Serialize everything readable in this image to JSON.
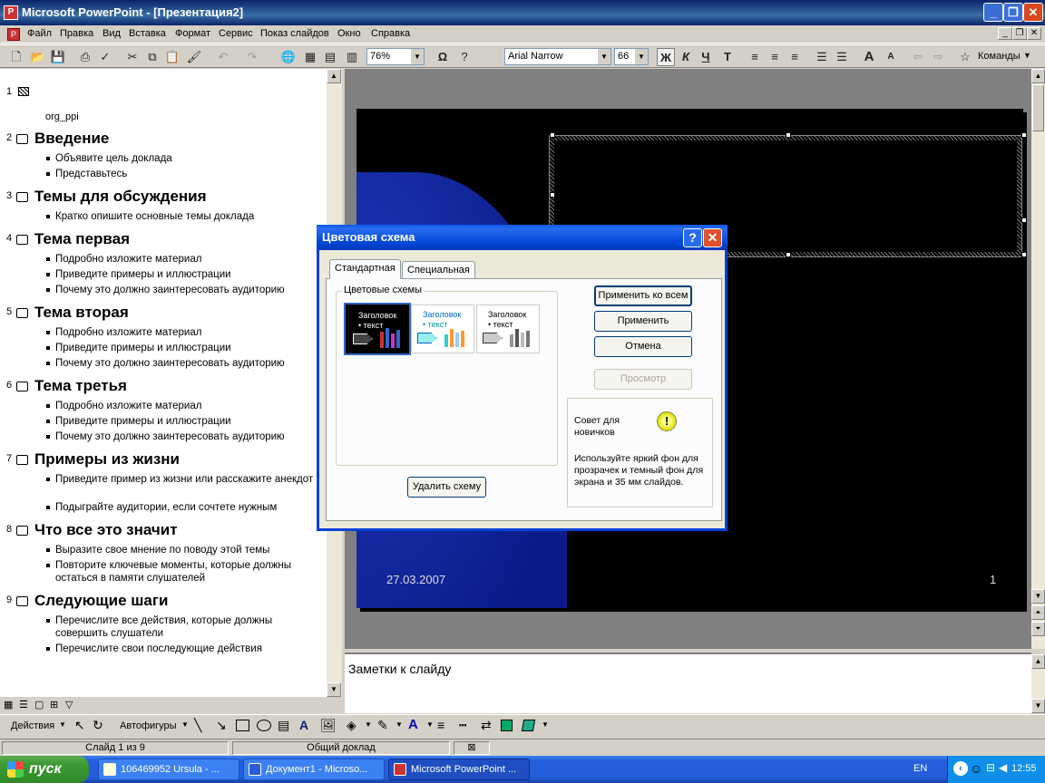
{
  "window": {
    "title": "Microsoft PowerPoint - [Презентация2]",
    "app_icon": "powerpoint-icon",
    "min_glyph": "_",
    "restore_glyph": "❐",
    "close_glyph": "✕"
  },
  "menu": {
    "items": [
      "Файл",
      "Правка",
      "Вид",
      "Вставка",
      "Формат",
      "Сервис",
      "Показ слайдов",
      "Окно",
      "Справка"
    ]
  },
  "toolbar": {
    "zoom": "76%",
    "font_name": "Arial Narrow",
    "font_size": "66",
    "bold": "Ж",
    "italic": "К",
    "underline": "Ч",
    "shadow": "Т",
    "commands_label": "Команды"
  },
  "outline": {
    "slides": [
      {
        "num": "1",
        "title": "",
        "subtitle": "org_ppi",
        "bullets": []
      },
      {
        "num": "2",
        "title": "Введение",
        "bullets": [
          "Объявите цель доклада",
          "Представьтесь"
        ]
      },
      {
        "num": "3",
        "title": "Темы для обсуждения",
        "bullets": [
          "Кратко опишите основные темы доклада"
        ]
      },
      {
        "num": "4",
        "title": "Тема первая",
        "bullets": [
          "Подробно изложите материал",
          "Приведите примеры и иллюстрации",
          "Почему это должно заинтересовать аудиторию"
        ]
      },
      {
        "num": "5",
        "title": "Тема вторая",
        "bullets": [
          "Подробно изложите материал",
          "Приведите примеры и иллюстрации",
          "Почему это должно заинтересовать аудиторию"
        ]
      },
      {
        "num": "6",
        "title": "Тема третья",
        "bullets": [
          "Подробно изложите материал",
          "Приведите примеры и иллюстрации",
          "Почему это должно заинтересовать аудиторию"
        ]
      },
      {
        "num": "7",
        "title": "Примеры из жизни",
        "bullets": [
          "Приведите пример из жизни или расскажите анекдот",
          "Подыграйте аудитории, если сочтете нужным"
        ]
      },
      {
        "num": "8",
        "title": "Что все это значит",
        "bullets": [
          "Выразите свое мнение по поводу этой темы",
          "Повторите ключевые моменты, которые должны остаться в памяти слушателей"
        ]
      },
      {
        "num": "9",
        "title": "Следующие шаги",
        "bullets": [
          "Перечислите все действия, которые должны совершить слушатели",
          "Перечислите свои последующие действия"
        ]
      }
    ]
  },
  "slide": {
    "date": "27.03.2007",
    "page": "1"
  },
  "notes": {
    "placeholder": "Заметки к слайду"
  },
  "dialog": {
    "title": "Цветовая схема",
    "help_glyph": "?",
    "close_glyph": "✕",
    "tabs": [
      "Стандартная",
      "Специальная"
    ],
    "group_label": "Цветовые схемы",
    "scheme_title": "Заголовок",
    "scheme_text": "• текст",
    "buttons": {
      "apply_all": "Применить ко всем",
      "apply": "Применить",
      "cancel": "Отмена",
      "preview": "Просмотр",
      "delete": "Удалить схему"
    },
    "tip_title": "Совет для новичков",
    "tip_text": "Используйте яркий фон для прозрачек и темный фон для экрана и 35 мм слайдов."
  },
  "drawbar": {
    "actions": "Действия",
    "autoshapes": "Автофигуры"
  },
  "status": {
    "slide": "Слайд 1 из 9",
    "design": "Общий доклад"
  },
  "taskbar": {
    "start": "пуск",
    "tasks": [
      "106469952 Ursula - ...",
      "Документ1 - Microso...",
      "Microsoft PowerPoint ..."
    ],
    "lang": "EN",
    "time": "12:55"
  }
}
